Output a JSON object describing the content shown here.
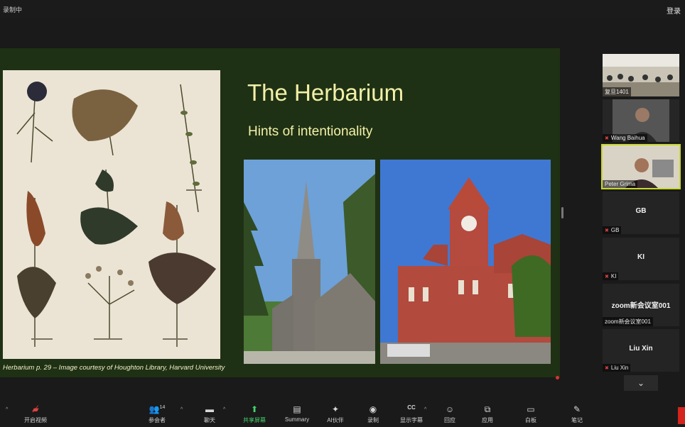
{
  "window": {
    "recording_label": "录制中",
    "login_label": "登录"
  },
  "slide": {
    "title": "The Herbarium",
    "subtitle": "Hints of intentionality",
    "caption": "Herbarium p. 29 – Image courtesy of Houghton Library, Harvard University"
  },
  "participants": [
    {
      "name": "复旦1401",
      "type": "video"
    },
    {
      "name": "Wang Baihua",
      "type": "video",
      "muted": true
    },
    {
      "name": "Peter Grima",
      "type": "video",
      "active": true
    },
    {
      "name": "GB",
      "display": "GB",
      "muted": true
    },
    {
      "name": "KI",
      "display": "KI",
      "muted": true
    },
    {
      "name": "zoom新会议室001",
      "display": "zoom新会议室001"
    },
    {
      "name": "Liu Xin",
      "display": "Liu Xin",
      "muted": true
    }
  ],
  "toolbar": {
    "video": "开启视频",
    "participants": "参会者",
    "participants_count": "14",
    "chat": "聊天",
    "share": "共享屏幕",
    "summary": "Summary",
    "ai": "AI伙伴",
    "record": "录制",
    "captions": "显示字幕",
    "captions_badge": "CC",
    "reactions": "回应",
    "apps": "应用",
    "whiteboard": "白板",
    "notes": "笔记"
  },
  "colors": {
    "slide_bg": "#1f3114",
    "title": "#f2f0a8",
    "active_border": "#c8d82a",
    "share_green": "#45d16a"
  }
}
